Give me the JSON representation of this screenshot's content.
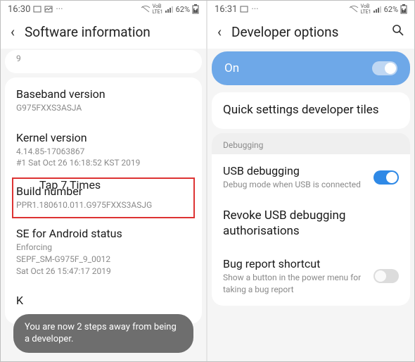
{
  "left": {
    "status": {
      "time": "16:30",
      "battery": "62%"
    },
    "title": "Software information",
    "android_version_partial": "9",
    "baseband": {
      "label": "Baseband version",
      "value": "G975FXXS3ASJA"
    },
    "kernel": {
      "label": "Kernel version",
      "line1": "4.14.85-17063867",
      "line2": "#1 Sat Oct 26 16:18:52 KST 2019"
    },
    "tap_note": "Tap 7 Times",
    "build": {
      "label": "Build number",
      "value": "PPR1.180610.011.G975FXXS3ASJG"
    },
    "se": {
      "label": "SE for Android status",
      "line1": "Enforcing",
      "line2": "SEPF_SM-G975F_9_0012",
      "line3": "Sat Oct 26 15:47:17 2019"
    },
    "knox_partial": "K",
    "toast": "You are now 2 steps away from being a developer."
  },
  "right": {
    "status": {
      "time": "16:31",
      "battery": "62%"
    },
    "title": "Developer options",
    "master_toggle": "On",
    "quick_tiles": "Quick settings developer tiles",
    "section_debugging": "Debugging",
    "usb_debug": {
      "label": "USB debugging",
      "sub": "Debug mode when USB is connected"
    },
    "revoke": "Revoke USB debugging authorisations",
    "bugreport": {
      "label": "Bug report shortcut",
      "sub": "Show a button in the power menu for taking a bug report"
    }
  }
}
